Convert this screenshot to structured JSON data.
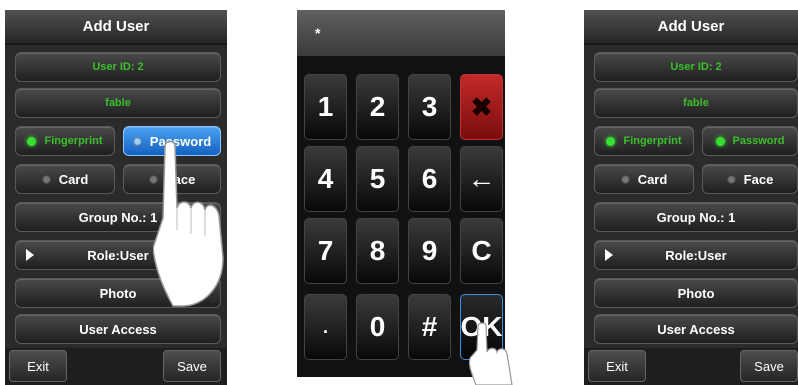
{
  "panel1": {
    "header": "Add User",
    "user_id": "User ID: 2",
    "name": "fable",
    "fingerprint": "Fingerprint",
    "password": "Password",
    "card": "Card",
    "face": "Face",
    "group": "Group No.: 1",
    "role": "Role:User",
    "photo": "Photo",
    "access": "User Access",
    "exit": "Exit",
    "save": "Save"
  },
  "keypad": {
    "display": "*",
    "keys": [
      "1",
      "2",
      "3",
      "4",
      "5",
      "6",
      "7",
      "8",
      "9",
      ".",
      "0",
      "#",
      "C",
      "OK"
    ],
    "backspace_glyph": "←",
    "delete_glyph": "✖"
  },
  "panel3": {
    "header": "Add User",
    "user_id": "User ID: 2",
    "name": "fable",
    "fingerprint": "Fingerprint",
    "password": "Password",
    "card": "Card",
    "face": "Face",
    "group": "Group No.: 1",
    "role": "Role:User",
    "photo": "Photo",
    "access": "User Access",
    "exit": "Exit",
    "save": "Save"
  },
  "colors": {
    "accent_green": "#3bbf2b",
    "selected_blue": "#1f7ad6",
    "delete_red": "#b01818"
  }
}
